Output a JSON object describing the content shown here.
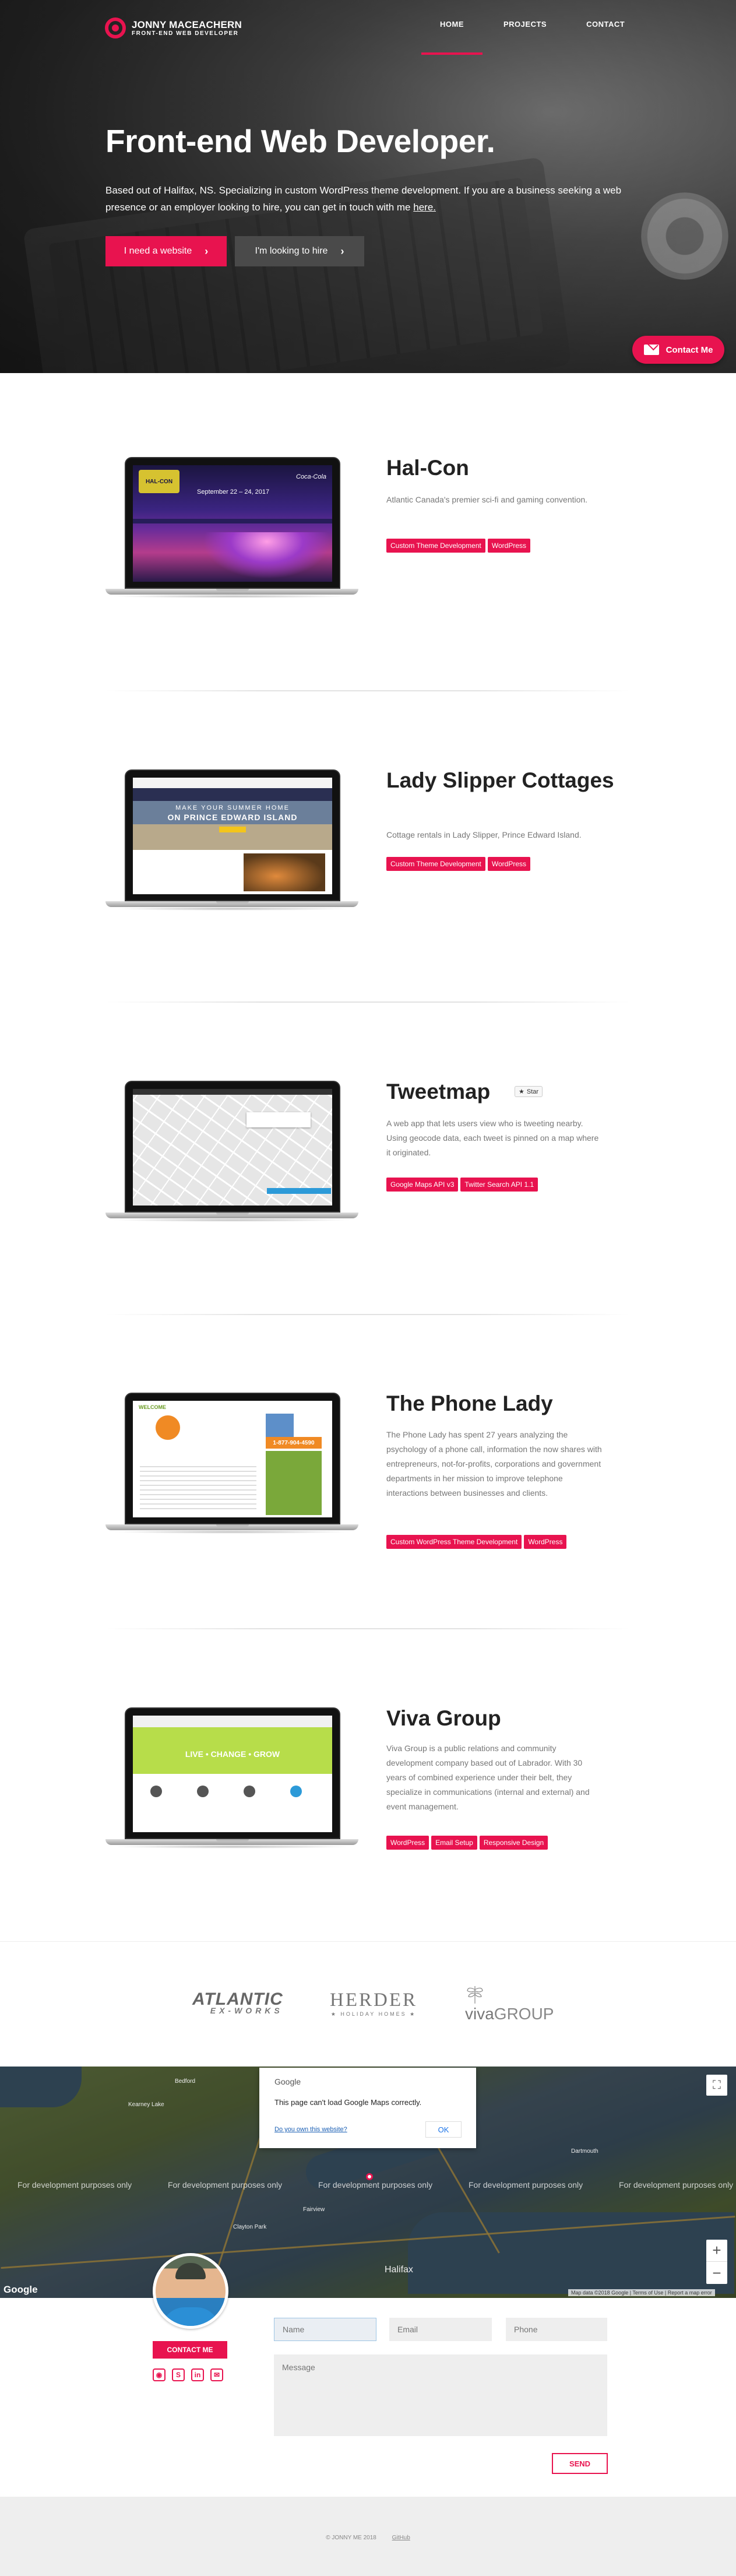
{
  "brand": {
    "name": "JONNY MACEACHERN",
    "tagline": "FRONT-END WEB DEVELOPER"
  },
  "nav": {
    "home": "HOME",
    "projects": "PROJECTS",
    "contact": "CONTACT"
  },
  "hero": {
    "title": "Front-end Web Developer.",
    "lead_text": "Based out of Halifax, NS. Specializing in custom WordPress theme development. If you are a business seeking a web presence or an employer looking to hire, you can get in touch with me",
    "lead_link": "here.",
    "btn_website": "I need a website",
    "btn_hire": "I'm looking to hire"
  },
  "fab": {
    "label": "Contact Me"
  },
  "projects": [
    {
      "title": "Hal-Con",
      "desc": "Atlantic Canada's premier sci-fi and gaming convention.",
      "tags": [
        "Custom Theme Development",
        "WordPress"
      ]
    },
    {
      "title": "Lady Slipper Cottages",
      "desc": "Cottage rentals in Lady Slipper, Prince Edward Island.",
      "tags": [
        "Custom Theme Development",
        "WordPress"
      ]
    },
    {
      "title": "Tweetmap",
      "star": "Star",
      "desc": "A web app that lets users view who is tweeting nearby. Using geocode data, each tweet is pinned on a map where it originated.",
      "tags": [
        "Google Maps API v3",
        "Twitter Search API 1.1"
      ]
    },
    {
      "title": "The Phone Lady",
      "desc": "The Phone Lady has spent 27 years analyzing the psychology of a phone call, information the now shares with entrepreneurs, not-for-profits, corporations and government departments in her mission to improve telephone interactions between businesses and clients.",
      "tags": [
        "Custom WordPress Theme Development",
        "WordPress"
      ]
    },
    {
      "title": "Viva Group",
      "desc": "Viva Group is a public relations and community development company based out of Labrador. With 30 years of combined experience under their belt, they specialize in communications (internal and external) and event management.",
      "tags": [
        "WordPress",
        "Email Setup",
        "Responsive Design"
      ]
    }
  ],
  "screens": {
    "halcon_date": "September 22 – 24, 2017",
    "halcon_logo": "HAL-CON",
    "halcon_sponsor": "Coca-Cola",
    "lady_line1": "MAKE YOUR SUMMER HOME",
    "lady_line2": "ON PRINCE EDWARD ISLAND",
    "phone_brand": "WELCOME",
    "phone_number": "1-877-904-4590",
    "viva_hero": "LIVE • CHANGE • GROW"
  },
  "clients": {
    "atlantic": "ATLANTIC",
    "atlantic_sub": "EX-WORKS",
    "herder": "HERDER",
    "herder_sub": "★ HOLIDAY HOMES ★",
    "viva": "viva",
    "viva_sub": "GROUP"
  },
  "map": {
    "dialog_brand": "Google",
    "dialog_message": "This page can't load Google Maps correctly.",
    "dialog_link": "Do you own this website?",
    "dialog_ok": "OK",
    "dev_watermark": "For development purposes only",
    "google": "Google",
    "footer": "Map data ©2018 Google | Terms of Use | Report a map error",
    "places": [
      "Halifax",
      "Kearney Lake",
      "Clayton Park",
      "Bedford",
      "Fairview",
      "Dartmouth"
    ]
  },
  "contact": {
    "button": "CONTACT ME",
    "name_ph": "Name",
    "email_ph": "Email",
    "phone_ph": "Phone",
    "message_ph": "Message",
    "send": "SEND"
  },
  "footer": {
    "copyright": "© JONNY ME 2018",
    "github": "GitHub"
  },
  "colors": {
    "accent": "#e8134f"
  }
}
